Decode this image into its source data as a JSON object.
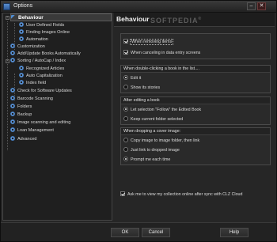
{
  "window": {
    "title": "Options",
    "minimize_glyph": "–",
    "close_glyph": "✕"
  },
  "tree": {
    "items": [
      {
        "label": "Behaviour",
        "icon": "tools-icon",
        "selected": true
      },
      {
        "label": "User Defined Fields",
        "icon": "gear-icon"
      },
      {
        "label": "Finding Images Online",
        "icon": "gear-icon"
      },
      {
        "label": "Automation",
        "icon": "gear-icon"
      },
      {
        "label": "Customization",
        "icon": "gear-icon"
      },
      {
        "label": "Add/Update Books Automatically",
        "icon": "gear-icon"
      },
      {
        "label": "Sorting / AutoCap / Index",
        "icon": "gear-icon"
      },
      {
        "label": "Recognized Articles",
        "icon": "gear-icon"
      },
      {
        "label": "Auto Capitalization",
        "icon": "gear-icon"
      },
      {
        "label": "Index field",
        "icon": "gear-icon"
      },
      {
        "label": "Check for Software Updates",
        "icon": "gear-icon"
      },
      {
        "label": "Barcode Scanning",
        "icon": "gear-icon"
      },
      {
        "label": "Folders",
        "icon": "gear-icon"
      },
      {
        "label": "Backup",
        "icon": "gear-icon"
      },
      {
        "label": "Image scanning and editing",
        "icon": "gear-icon"
      },
      {
        "label": "Loan Management",
        "icon": "gear-icon"
      },
      {
        "label": "Advanced",
        "icon": "gear-icon"
      }
    ]
  },
  "panel": {
    "title": "Behaviour",
    "watermark": "SOFTPEDIA",
    "watermark_mark": "®",
    "confirm_group": {
      "options": [
        {
          "label": "When removing items",
          "checked": true
        },
        {
          "label": "When canceling in data entry screens",
          "checked": true
        }
      ]
    },
    "double_click_group": {
      "header": "When double-clicking a book in the list....",
      "options": [
        {
          "label": "Edit it",
          "checked": true
        },
        {
          "label": "Show its stories",
          "checked": false
        }
      ]
    },
    "after_edit_group": {
      "header": "After editing a book",
      "options": [
        {
          "label": "Let selection \"Follow\" the Edited Book",
          "checked": true
        },
        {
          "label": "Keep current folder selected",
          "checked": false
        }
      ]
    },
    "cover_group": {
      "header": "When dropping a cover image:",
      "options": [
        {
          "label": "Copy image to image folder, then link",
          "checked": false
        },
        {
          "label": "Just link to dropped image",
          "checked": false
        },
        {
          "label": "Prompt me each time",
          "checked": true
        }
      ]
    },
    "sync_option": {
      "label": "Ask me to view my collection online after sync with CLZ Cloud",
      "checked": true
    }
  },
  "buttons": {
    "ok": "OK",
    "cancel": "Cancel",
    "help": "Help"
  }
}
